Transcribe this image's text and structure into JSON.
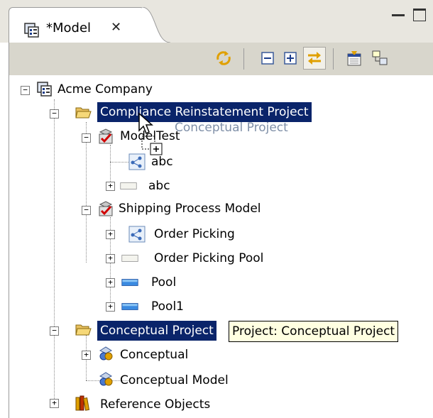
{
  "view": {
    "tab_title": "*Model",
    "tab_close_glyph": "✕",
    "tab_icon": "model-tree-icon"
  },
  "toolbar": {
    "buttons": [
      {
        "name": "sync-icon",
        "pressed": false
      },
      {
        "name": "collapse-all-icon",
        "pressed": false
      },
      {
        "name": "expand-all-icon",
        "pressed": false
      },
      {
        "name": "link-with-editor-icon",
        "pressed": true
      },
      {
        "name": "filter-icon",
        "pressed": false
      },
      {
        "name": "hierarchy-layout-icon",
        "pressed": false
      }
    ]
  },
  "tree": {
    "root": "Acme Company",
    "project1": "Compliance Reinstatement Project",
    "modeltest": "ModelTest",
    "abc_process": "abc",
    "abc_pool": "abc",
    "shipping": "Shipping Process Model",
    "order_picking": "Order Picking",
    "order_picking_pool": "Order Picking Pool",
    "pool": "Pool",
    "pool1": "Pool1",
    "project2": "Conceptual Project",
    "conceptual": "Conceptual",
    "conceptual_model": "Conceptual Model",
    "reference": "Reference Objects"
  },
  "drag": {
    "ghost_label": "Conceptual Project"
  },
  "tooltip": {
    "text": "Project: Conceptual Project"
  },
  "colors": {
    "selection": "#0a246a",
    "tooltip_bg": "#ffffe1",
    "toolbar_bg": "#d8d6cc"
  }
}
